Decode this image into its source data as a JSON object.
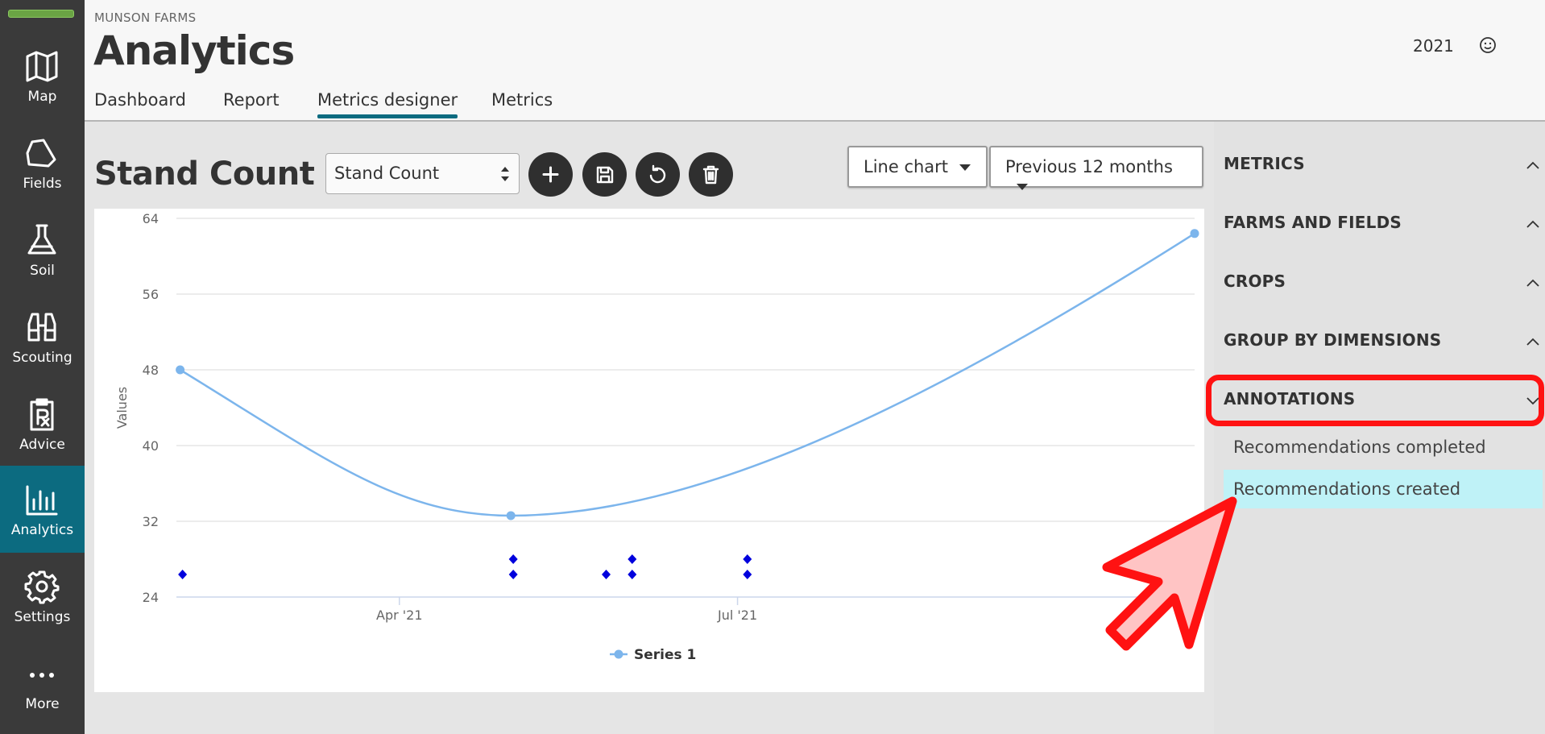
{
  "sidebar": {
    "items": [
      {
        "label": "Map",
        "icon": "map-icon"
      },
      {
        "label": "Fields",
        "icon": "field-icon"
      },
      {
        "label": "Soil",
        "icon": "flask-icon"
      },
      {
        "label": "Scouting",
        "icon": "binoculars-icon"
      },
      {
        "label": "Advice",
        "icon": "prescription-icon"
      },
      {
        "label": "Analytics",
        "icon": "bar-chart-icon"
      },
      {
        "label": "Settings",
        "icon": "gear-icon"
      },
      {
        "label": "More",
        "icon": "ellipsis-icon"
      }
    ],
    "active": "Analytics"
  },
  "header": {
    "farm_name": "MUNSON FARMS",
    "title": "Analytics",
    "year": "2021",
    "tabs": [
      {
        "label": "Dashboard"
      },
      {
        "label": "Report"
      },
      {
        "label": "Metrics designer"
      },
      {
        "label": "Metrics"
      }
    ],
    "active_tab": "Metrics designer"
  },
  "toolbar": {
    "metric_title": "Stand Count",
    "metric_select_value": "Stand Count",
    "chart_type": "Line chart",
    "period": "Previous 12 months"
  },
  "panel": {
    "sections": [
      {
        "label": "METRICS"
      },
      {
        "label": "FARMS AND FIELDS"
      },
      {
        "label": "CROPS"
      },
      {
        "label": "GROUP BY DIMENSIONS"
      },
      {
        "label": "ANNOTATIONS"
      }
    ],
    "annotation_items": [
      {
        "label": "Recommendations completed"
      },
      {
        "label": "Recommendations created",
        "highlighted": true
      }
    ]
  },
  "colors": {
    "sidebar_bg": "#3a3a3a",
    "active_nav": "#0c6b80",
    "series": "#7cb5ec",
    "annotation_marker": "#0000dd",
    "highlight": "#ff1212",
    "selected_item": "#bff2f7"
  },
  "chart_data": {
    "type": "line",
    "ylabel": "Values",
    "ylim": [
      24,
      64
    ],
    "yticks": [
      24,
      32,
      40,
      48,
      56,
      64
    ],
    "xticks": [
      "Apr '21",
      "Jul '21"
    ],
    "legend": "bottom",
    "grid": true,
    "series": [
      {
        "name": "Series 1",
        "x": [
          "2021-02-01",
          "2021-05-01",
          "2021-11-01"
        ],
        "values": [
          48,
          32.6,
          62.4
        ]
      }
    ],
    "annotations": [
      {
        "x": "2021-02-01",
        "row": 1
      },
      {
        "x": "2021-05-01",
        "row": 1
      },
      {
        "x": "2021-05-01",
        "row": 2
      },
      {
        "x": "2021-05-26",
        "row": 1
      },
      {
        "x": "2021-06-02",
        "row": 1
      },
      {
        "x": "2021-06-02",
        "row": 2
      },
      {
        "x": "2021-07-03",
        "row": 1
      },
      {
        "x": "2021-07-03",
        "row": 2
      }
    ]
  }
}
